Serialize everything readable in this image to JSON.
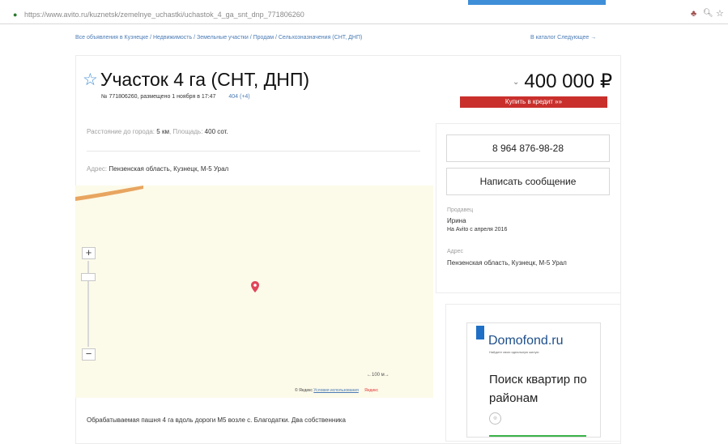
{
  "browser": {
    "url": "https://www.avito.ru/kuznetsk/zemelnye_uchastki/uchastok_4_ga_snt_dnp_771806260",
    "lock_icon": "lock-icon",
    "ext_icon": "extension-icon"
  },
  "breadcrumb": {
    "path": "Все объявления в Кузнецке / Недвижимость / Земельные участки / Продам / Сельхозназначения (СНТ, ДНП)",
    "right": "В каталог   Следующее →"
  },
  "listing": {
    "title": "Участок 4 га (СНТ, ДНП)",
    "meta": "№ 771806260, размещено 1 ноября в 17:47",
    "views": "404 (+4)",
    "price": "400 000 ₽",
    "credit_button": "Купить в кредит »»",
    "params_label1": "Расстояние до города:",
    "params_value1": "5 км",
    "params_label2": "Площадь:",
    "params_value2": "400 сот.",
    "address_label": "Адрес:",
    "address_value": "Пензенская область, Кузнецк, М-5 Урал",
    "description": "Обрабатываемая пашня 4 га вдоль дороги М5 возле с. Благодатки. Два собственника"
  },
  "map": {
    "zoom_in": "+",
    "zoom_out": "−",
    "scale": "←100 м→",
    "attribution": "© Яндекс",
    "terms": "Условия использования",
    "logo": "Яндекс"
  },
  "contact": {
    "phone": "8 964 876-98-28",
    "message_button": "Написать сообщение",
    "seller_label": "Продавец",
    "seller_name": "Ирина",
    "seller_since": "На Avito с апреля 2016",
    "address_label": "Адрес",
    "address_value": "Пензенская область, Кузнецк, М-5 Урал"
  },
  "ad": {
    "brand": "Domofond.ru",
    "tagline": "Найдите свою идеальную жилую",
    "headline": "Поиск квартир по районам"
  },
  "colors": {
    "accent": "#3f8fd8",
    "credit": "#c9302c",
    "map_bg": "#fcfae9",
    "pin": "#e0455a"
  }
}
